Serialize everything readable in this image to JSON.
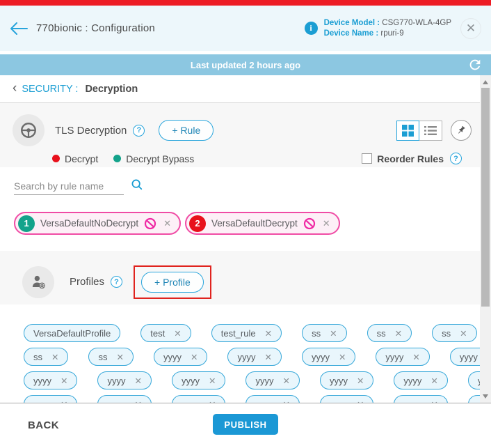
{
  "header": {
    "title": "770bionic : Configuration",
    "device_model_label": "Device Model :",
    "device_model_value": "CSG770-WLA-4GP",
    "device_name_label": "Device Name :",
    "device_name_value": "rpuri-9"
  },
  "update_bar": {
    "text": "Last updated 2 hours ago"
  },
  "breadcrumb": {
    "chevron": "‹",
    "section": "SECURITY :",
    "page": "Decryption"
  },
  "tls": {
    "title": "TLS Decryption",
    "add_rule_label": "+ Rule",
    "reorder_label": "Reorder Rules",
    "search_placeholder": "Search by rule name",
    "legend": [
      {
        "label": "Decrypt",
        "color": "#e8111c"
      },
      {
        "label": "Decrypt Bypass",
        "color": "#14a38b"
      }
    ],
    "rules": [
      {
        "index": "1",
        "name": "VersaDefaultNoDecrypt",
        "badge_color": "#14a38b"
      },
      {
        "index": "2",
        "name": "VersaDefaultDecrypt",
        "badge_color": "#e8111c"
      }
    ]
  },
  "profiles": {
    "title": "Profiles",
    "add_profile_label": "+ Profile",
    "rows": [
      [
        {
          "label": "VersaDefaultProfile",
          "removable": false
        },
        {
          "label": "test",
          "removable": true
        },
        {
          "label": "test_rule",
          "removable": true
        },
        {
          "label": "ss",
          "removable": true
        },
        {
          "label": "ss",
          "removable": true
        },
        {
          "label": "ss",
          "removable": true
        }
      ],
      [
        {
          "label": "ss",
          "removable": true
        },
        {
          "label": "ss",
          "removable": true
        },
        {
          "label": "yyyy",
          "removable": true
        },
        {
          "label": "yyyy",
          "removable": true
        },
        {
          "label": "yyyy",
          "removable": true
        },
        {
          "label": "yyyy",
          "removable": true
        },
        {
          "label": "yyyy",
          "removable": true
        }
      ],
      [
        {
          "label": "yyyy",
          "removable": true
        },
        {
          "label": "yyyy",
          "removable": true
        },
        {
          "label": "yyyy",
          "removable": true
        },
        {
          "label": "yyyy",
          "removable": true
        },
        {
          "label": "yyyy",
          "removable": true
        },
        {
          "label": "yyyy",
          "removable": true
        },
        {
          "label": "yyyy",
          "removable": true
        }
      ],
      [
        {
          "label": "yyyy",
          "removable": true
        },
        {
          "label": "yyyy",
          "removable": true
        },
        {
          "label": "yyyy",
          "removable": true
        },
        {
          "label": "yyyy",
          "removable": true
        },
        {
          "label": "yyyy",
          "removable": true
        },
        {
          "label": "yyyy",
          "removable": true
        },
        {
          "label": "yyyy",
          "removable": true
        }
      ]
    ]
  },
  "footer": {
    "back_label": "BACK",
    "publish_label": "PUBLISH"
  },
  "colors": {
    "top_bar_red": "#ed1c24",
    "accent_cyan": "#29a5dc",
    "link_blue": "#1b9ed3",
    "update_bar_blue": "#8cc7e1",
    "section_gray": "#f7f7f7",
    "rule_chip_border": "#f04ba5",
    "rule_chip_bg": "#fdf0f7",
    "no_entry_magenta": "#ef2aa4",
    "profile_chip_border": "#35a7d9",
    "profile_chip_bg": "#e9f6fc",
    "publish_blue": "#1b98d5",
    "annotation_red": "#e0231e"
  }
}
